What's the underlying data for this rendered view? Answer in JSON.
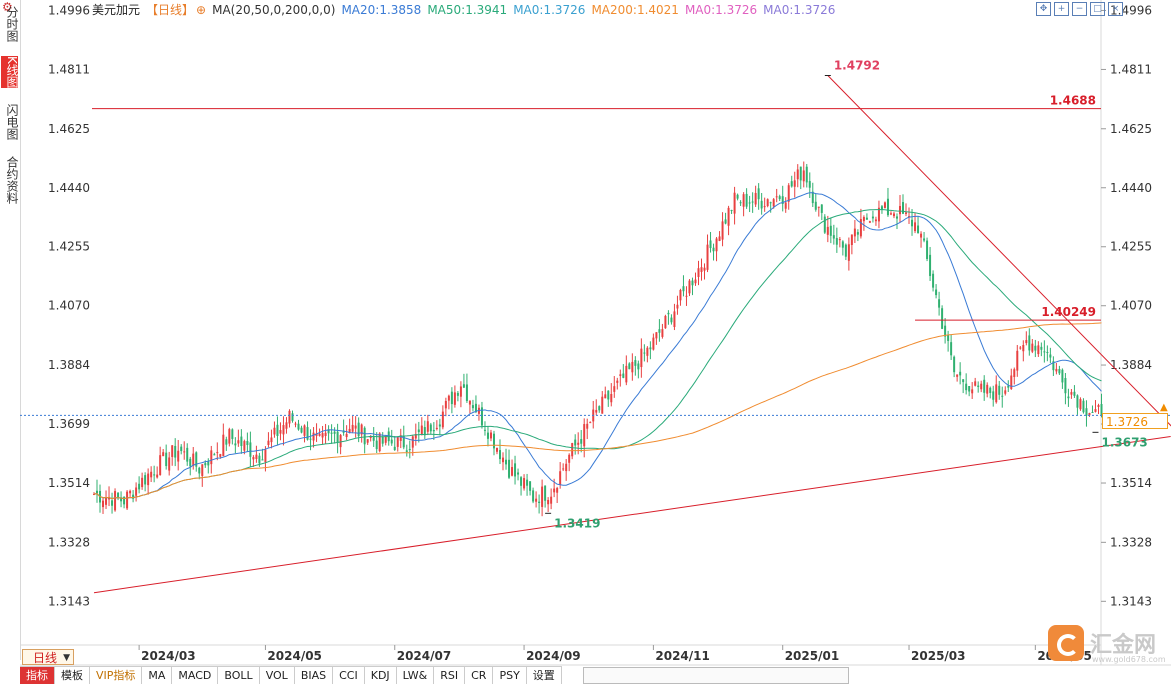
{
  "header": {
    "symbol": "美元加元",
    "period": "【日线】",
    "add_icon": "plus-circle-icon",
    "ma_config": "MA(20,50,0,200,0,0)",
    "ma_values": [
      {
        "label": "MA20:1.3858",
        "color": "#3a7bd5"
      },
      {
        "label": "MA50:1.3941",
        "color": "#2aaa7a"
      },
      {
        "label": "MA0:1.3726",
        "color": "#3aa0d0"
      },
      {
        "label": "MA200:1.4021",
        "color": "#f08c30"
      },
      {
        "label": "MA0:1.3726",
        "color": "#e060c0"
      },
      {
        "label": "MA0:1.3726",
        "color": "#8a7ad8"
      }
    ]
  },
  "toolbar_icons": [
    "move-icon",
    "zoom-in-icon",
    "zoom-out-icon",
    "maximize-icon",
    "close-icon"
  ],
  "sidebar": {
    "settings_icon": "gear-icon",
    "tabs": [
      {
        "label": "分时图",
        "active": false
      },
      {
        "label": "K线图",
        "active": true
      },
      {
        "label": "闪电图",
        "active": false
      },
      {
        "label": "合约资料",
        "active": false
      }
    ]
  },
  "current_price": "1.3726",
  "watermark": {
    "text": "汇金网",
    "url": "www.gold678.com"
  },
  "period_select": "日线",
  "bottom_tabs": [
    {
      "label": "指标",
      "active": true
    },
    {
      "label": "模板"
    },
    {
      "label": "VIP指标",
      "vip": true
    },
    {
      "label": "MA"
    },
    {
      "label": "MACD"
    },
    {
      "label": "BOLL"
    },
    {
      "label": "VOL"
    },
    {
      "label": "BIAS"
    },
    {
      "label": "CCI"
    },
    {
      "label": "KDJ"
    },
    {
      "label": "LW&"
    },
    {
      "label": "RSI"
    },
    {
      "label": "CR"
    },
    {
      "label": "PSY"
    },
    {
      "label": "设置"
    }
  ],
  "chart_data": {
    "type": "candlestick",
    "title": "美元加元",
    "y_ticks": [
      "1.4996",
      "1.4811",
      "1.4625",
      "1.4440",
      "1.4255",
      "1.4070",
      "1.3884",
      "1.3699",
      "1.3514",
      "1.3328",
      "1.3143"
    ],
    "ylim": [
      1.3006,
      1.501
    ],
    "x_ticks": [
      {
        "label": "2024/03",
        "index": 15
      },
      {
        "label": "2024/05",
        "index": 57
      },
      {
        "label": "2024/07",
        "index": 100
      },
      {
        "label": "2024/09",
        "index": 143
      },
      {
        "label": "2024/11",
        "index": 186
      },
      {
        "label": "2025/01",
        "index": 229
      },
      {
        "label": "2025/03",
        "index": 271
      },
      {
        "label": "2025/05",
        "index": 313
      }
    ],
    "bar_count": 336,
    "colors": {
      "up": "#e84040",
      "down": "#30b070"
    },
    "anchors": [
      [
        0,
        1.348
      ],
      [
        10,
        1.346
      ],
      [
        20,
        1.356
      ],
      [
        28,
        1.362
      ],
      [
        35,
        1.356
      ],
      [
        45,
        1.366
      ],
      [
        55,
        1.36
      ],
      [
        65,
        1.372
      ],
      [
        75,
        1.364
      ],
      [
        85,
        1.369
      ],
      [
        95,
        1.364
      ],
      [
        105,
        1.364
      ],
      [
        115,
        1.372
      ],
      [
        122,
        1.383
      ],
      [
        130,
        1.37
      ],
      [
        138,
        1.356
      ],
      [
        146,
        1.347
      ],
      [
        152,
        1.349
      ],
      [
        158,
        1.36
      ],
      [
        166,
        1.372
      ],
      [
        175,
        1.383
      ],
      [
        185,
        1.394
      ],
      [
        195,
        1.409
      ],
      [
        205,
        1.425
      ],
      [
        213,
        1.44
      ],
      [
        222,
        1.44
      ],
      [
        230,
        1.442
      ],
      [
        236,
        1.45
      ],
      [
        242,
        1.434
      ],
      [
        250,
        1.424
      ],
      [
        258,
        1.436
      ],
      [
        266,
        1.437
      ],
      [
        274,
        1.432
      ],
      [
        280,
        1.41
      ],
      [
        286,
        1.386
      ],
      [
        294,
        1.38
      ],
      [
        302,
        1.38
      ],
      [
        310,
        1.396
      ],
      [
        316,
        1.394
      ],
      [
        322,
        1.383
      ],
      [
        330,
        1.375
      ],
      [
        335,
        1.3726
      ]
    ],
    "series": [
      {
        "name": "MA20",
        "value": "1.3858",
        "color": "#3a7bd5"
      },
      {
        "name": "MA50",
        "value": "1.3941",
        "color": "#2aaa7a"
      },
      {
        "name": "MA200",
        "value": "1.4021",
        "color": "#f08c30"
      }
    ],
    "annotations": [
      {
        "type": "hline",
        "label": "1.4688",
        "value": 1.4688,
        "color": "#d81e2a"
      },
      {
        "type": "hline",
        "label": "1.40249",
        "value": 1.40249,
        "from_index": 273,
        "color": "#d81e2a"
      },
      {
        "type": "trendline",
        "from": [
          0,
          1.317
        ],
        "to": [
          358,
          1.366
        ],
        "color": "#d81e2a"
      },
      {
        "type": "trendline",
        "from": [
          244,
          1.4792
        ],
        "to": [
          367,
          1.3608
        ],
        "color": "#d81e2a"
      },
      {
        "type": "label",
        "text": "1.4792",
        "index": 244,
        "value": 1.4792,
        "color": "#e04060"
      },
      {
        "type": "label",
        "text": "1.3419",
        "index": 151,
        "value": 1.3419,
        "color": "#30a070"
      },
      {
        "type": "label",
        "text": "1.3673",
        "index": 333,
        "value": 1.3673,
        "color": "#30a070"
      }
    ],
    "current_price_line": 1.3726
  }
}
